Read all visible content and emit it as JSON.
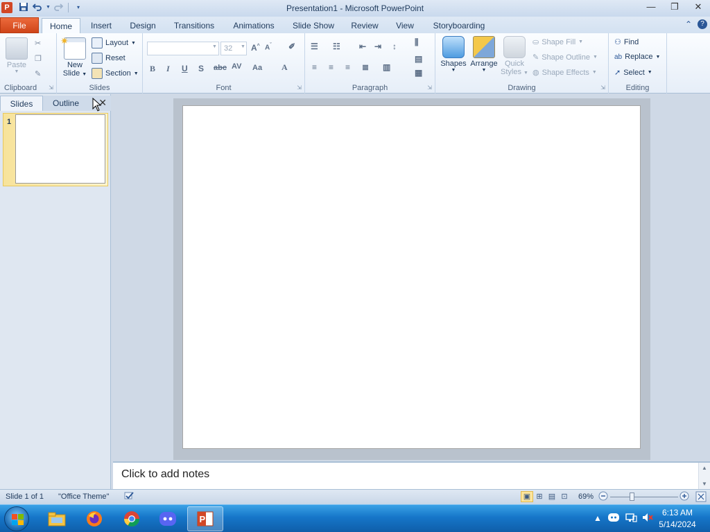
{
  "window": {
    "title": "Presentation1 - Microsoft PowerPoint",
    "app_icon_letter": "P",
    "controls": [
      "minimize-icon",
      "restore-icon",
      "close-icon"
    ]
  },
  "quick_access": [
    "save-icon",
    "undo-icon",
    "redo-icon",
    "customize-icon"
  ],
  "tabs": [
    "File",
    "Home",
    "Insert",
    "Design",
    "Transitions",
    "Animations",
    "Slide Show",
    "Review",
    "View",
    "Storyboarding"
  ],
  "active_tab": "Home",
  "ribbon": {
    "clipboard": {
      "label": "Clipboard",
      "paste": "Paste"
    },
    "slides": {
      "label": "Slides",
      "new_slide_1": "New",
      "new_slide_2": "Slide",
      "layout": "Layout",
      "reset": "Reset",
      "section": "Section"
    },
    "font": {
      "label": "Font",
      "font_name": "",
      "font_size": "32"
    },
    "paragraph": {
      "label": "Paragraph"
    },
    "drawing": {
      "label": "Drawing",
      "shapes": "Shapes",
      "arrange": "Arrange",
      "quick_styles_1": "Quick",
      "quick_styles_2": "Styles",
      "shape_fill": "Shape Fill",
      "shape_outline": "Shape Outline",
      "shape_effects": "Shape Effects"
    },
    "editing": {
      "label": "Editing",
      "find": "Find",
      "replace": "Replace",
      "select": "Select"
    }
  },
  "left_panel": {
    "tabs": [
      "Slides",
      "Outline"
    ],
    "active_tab": "Slides",
    "slides": [
      {
        "number": "1"
      }
    ]
  },
  "notes": {
    "placeholder": "Click to add notes"
  },
  "status": {
    "slide_info": "Slide 1 of 1",
    "theme": "\"Office Theme\"",
    "zoom": "69%"
  },
  "taskbar": {
    "apps": [
      "file-explorer-icon",
      "firefox-icon",
      "chrome-icon",
      "discord-icon",
      "powerpoint-icon"
    ],
    "active_app": "powerpoint-icon",
    "time": "6:13 AM",
    "date": "5/14/2024"
  },
  "colors": {
    "file_tab": "#d24726",
    "accent": "#2b5797",
    "taskbar": "#1676c9",
    "selected_thumb": "#f7e39a"
  }
}
